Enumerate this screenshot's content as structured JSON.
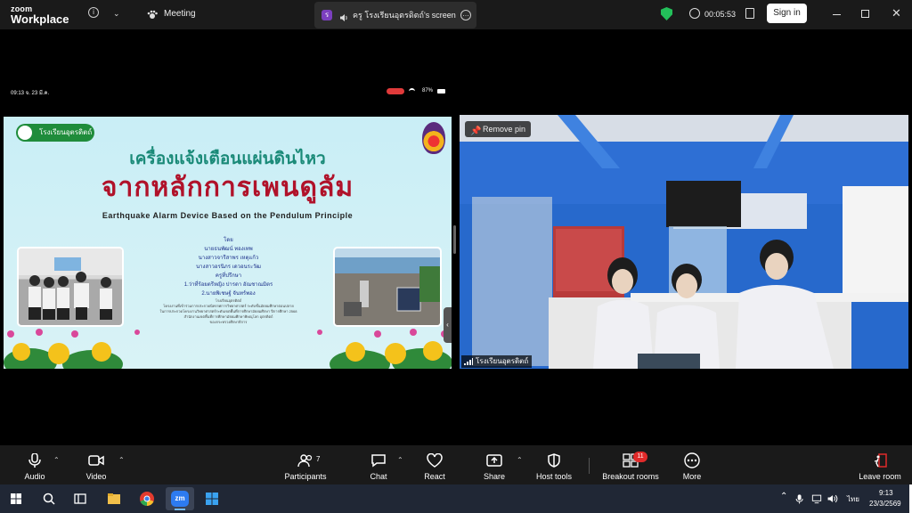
{
  "titlebar": {
    "logo_top": "zoom",
    "logo_bottom": "Workplace",
    "meeting_label": "Meeting",
    "share_badge": "ร",
    "share_title": "ครู โรงเรียนอุตรดิตถ์'s screen",
    "timer": "00:05:53",
    "signin_label": "Sign in"
  },
  "shared_screen": {
    "status_time": "09:13  จ. 23 มี.ค.",
    "status_battery": "87%",
    "slide": {
      "school_tag": "โรงเรียนอุตรดิตถ์",
      "title_line1": "เครื่องแจ้งเตือนแผ่นดินไหว",
      "title_line2": "จากหลักการเพนดูลัม",
      "subtitle": "Earthquake Alarm Device Based on the Pendulum Principle",
      "lines": [
        "โดย",
        "นายธนพัฒน์ ทองเทพ",
        "นางสาวจารีสาพร เหตุแก้ว",
        "นางสาวอรนิภร เดวอนระวัฒ",
        "ครูที่ปรึกษา",
        "1.ว่าที่ร้อยตรีหญิง ปารดา อัณชาณมิตร",
        "2.นายพิเชษฐ์ จันทร์พอง"
      ],
      "small_lines": [
        "โรงเรียนอุตรดิตถ์",
        "โครงงานที่เข้าร่วมการประกวดนิทรรศการวิทยาศาสตร์ ระดับชั้นมัธยมศึกษาตอนปลาย",
        "ในการประกวดโครงงานวิทยาศาสตร์ระดับเขตพื้นที่การศึกษามัธยมศึกษา ปีการศึกษา 2568",
        "สำนักงานเขตพื้นที่การศึกษามัธยมศึกษาพิษณุโลก อุตรดิตถ์",
        "ของกระทรวงศึกษาธิการ"
      ]
    }
  },
  "video_tile": {
    "remove_pin_label": "Remove pin",
    "name_tag": "โรงเรียนอุตรดิตถ์"
  },
  "toolbar": {
    "audio": "Audio",
    "video": "Video",
    "participants": "Participants",
    "participants_count": "7",
    "chat": "Chat",
    "react": "React",
    "share": "Share",
    "host_tools": "Host tools",
    "breakout_rooms": "Breakout rooms",
    "breakout_badge": "11",
    "more": "More",
    "leave": "Leave room"
  },
  "taskbar": {
    "app_label": "zm",
    "language": "ไทย",
    "time": "9:13",
    "date": "23/3/2569"
  },
  "colors": {
    "toolbar_bg": "#1a1a1a",
    "badge_red": "#e02a2a",
    "shield_green": "#23c05a",
    "slide_title_red": "#b0122a",
    "slide_title_teal": "#1a8a78"
  }
}
